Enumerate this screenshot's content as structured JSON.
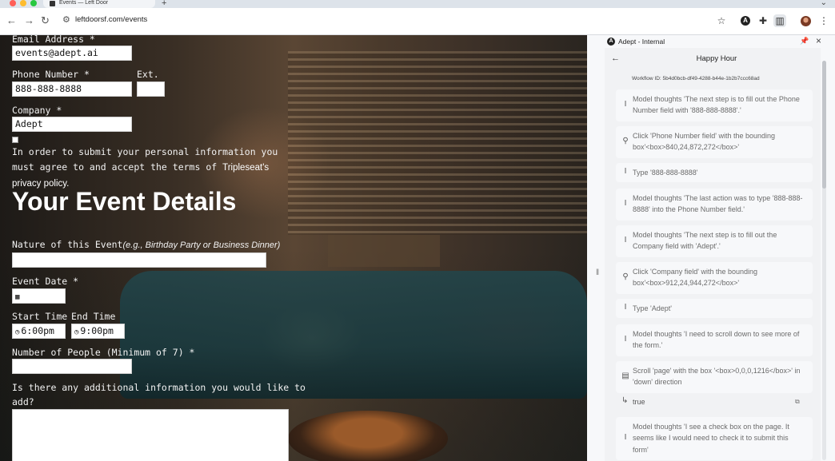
{
  "browser": {
    "tab_title": "Events — Left Door",
    "new_tab_icon": "plus-icon",
    "url": "leftdoorsf.com/events",
    "traffic_lights": [
      "#ff5f57",
      "#febc2e",
      "#28c840"
    ]
  },
  "form": {
    "email_label": "Email Address *",
    "email_value": "events@adept.ai",
    "phone_label": "Phone Number *",
    "phone_value": "888-888-8888",
    "ext_label": "Ext.",
    "ext_value": "",
    "company_label": "Company *",
    "company_value": "Adept",
    "consent_text": "In order to submit your personal information you must agree to and accept the terms of",
    "consent_link": "Tripleseat's privacy policy.",
    "section_heading": "Your Event Details",
    "nature_label": "Nature of this Event",
    "nature_hint": "(e.g., Birthday Party or Business Dinner)",
    "nature_value": "",
    "date_label": "Event Date *",
    "date_value": "",
    "start_label": "Start Time",
    "start_value": "6:00pm",
    "end_label": "End Time",
    "end_value": "9:00pm",
    "people_label": "Number of People (Minimum of 7) *",
    "people_value": "",
    "additional_label_1": "Is there any additional information you would like to",
    "additional_label_2": "add?",
    "additional_value": ""
  },
  "panel": {
    "app_title": "Adept - Internal",
    "workflow_title": "Happy Hour",
    "workflow_id": "Workflow ID: 5b4d0bcb-df49-4288-b44e-1b2b7ccc68ad",
    "steps": [
      {
        "icon": "text-cursor-icon",
        "text": "Model thoughts 'The next step is to fill out the Phone Number field with '888-888-8888'.'"
      },
      {
        "icon": "click-icon",
        "text": "Click 'Phone Number field' with the bounding box'<box>840,24,872,272</box>'"
      },
      {
        "icon": "text-cursor-icon",
        "text": "Type '888-888-8888'"
      },
      {
        "icon": "text-cursor-icon",
        "text": "Model thoughts 'The last action was to type '888-888-8888' into the Phone Number field.'"
      },
      {
        "icon": "text-cursor-icon",
        "text": "Model thoughts 'The next step is to fill out the Company field with 'Adept'.'"
      },
      {
        "icon": "click-icon",
        "text": "Click 'Company field' with the bounding box'<box>912,24,944,272</box>'"
      },
      {
        "icon": "text-cursor-icon",
        "text": "Type 'Adept'"
      },
      {
        "icon": "text-cursor-icon",
        "text": "Model thoughts 'I need to scroll down to see more of the form.'"
      },
      {
        "icon": "scroll-icon",
        "text": "Scroll 'page' with the box '<box>0,0,0,1216</box>' in 'down' direction"
      },
      {
        "icon": "text-cursor-icon",
        "text": "Model thoughts 'I see a check box on the page. It seems like I would need to check it to submit this form'"
      }
    ],
    "result_text": "true"
  }
}
